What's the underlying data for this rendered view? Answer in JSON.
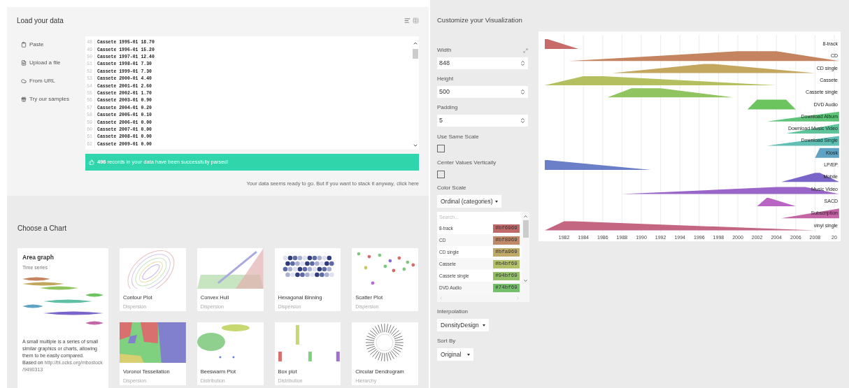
{
  "load_panel": {
    "title": "Load your data",
    "sources": [
      {
        "label": "Paste"
      },
      {
        "label": "Upload a file"
      },
      {
        "label": "From URL"
      },
      {
        "label": "Try our samples"
      }
    ],
    "data_lines": [
      {
        "number": "48",
        "text": "Cassete 1995-01 18.70"
      },
      {
        "number": "49",
        "text": "Cassete 1996-01 15.20"
      },
      {
        "number": "50",
        "text": "Cassete 1997-01 12.40"
      },
      {
        "number": "51",
        "text": "Cassete 1998-01 7.30"
      },
      {
        "number": "52",
        "text": "Cassete 1999-01 7.30"
      },
      {
        "number": "53",
        "text": "Cassete 2000-01 4.40"
      },
      {
        "number": "54",
        "text": "Cassete 2001-01 2.60"
      },
      {
        "number": "55",
        "text": "Cassete 2002-01 1.70"
      },
      {
        "number": "56",
        "text": "Cassete 2003-01 0.90"
      },
      {
        "number": "57",
        "text": "Cassete 2004-01 0.20"
      },
      {
        "number": "58",
        "text": "Cassete 2005-01 0.10"
      },
      {
        "number": "59",
        "text": "Cassete 2006-01 0.00"
      },
      {
        "number": "60",
        "text": "Cassete 2007-01 0.00"
      },
      {
        "number": "61",
        "text": "Cassete 2008-01 0.00"
      },
      {
        "number": "62",
        "text": "Cassete 2009-01 0.00"
      }
    ],
    "success_message": "**496** records in your data have been successfully parsed!",
    "stack_hint": "Your data seems ready to go. But if you want to stack it anyway,",
    "stack_link": "click here"
  },
  "chart_chooser": {
    "title": "Choose a Chart",
    "selected_chart": {
      "name": "Area graph",
      "category": "Time series",
      "description": "A small multiple is a series of small similar graphics or charts, allowing them to be easily compared.",
      "source_prefix": "Based on",
      "source_link_lines": [
        "http://bl.ocks.org/mbostock",
        "/9490313"
      ]
    },
    "charts": [
      {
        "name": "Contour Plot",
        "category": "Dispersion",
        "kind": "contour"
      },
      {
        "name": "Convex Hull",
        "category": "Dispersion",
        "kind": "hull"
      },
      {
        "name": "Hexagonal Binning",
        "category": "Dispersion",
        "kind": "hexbin"
      },
      {
        "name": "Scatter Plot",
        "category": "Dispersion",
        "kind": "scatter"
      },
      {
        "name": "Voronoi Tessellation",
        "category": "Dispersion",
        "kind": "voronoi"
      },
      {
        "name": "Beeswarm Plot",
        "category": "Distribution",
        "kind": "beeswarm"
      },
      {
        "name": "Box plot",
        "category": "Distribution",
        "kind": "boxplot"
      },
      {
        "name": "Circular Dendrogram",
        "category": "Hierarchy",
        "kind": "dendrogram"
      }
    ]
  },
  "customize": {
    "title": "Customize your Visualization",
    "width": {
      "label": "Width",
      "value": "848"
    },
    "height": {
      "label": "Height",
      "value": "500"
    },
    "padding": {
      "label": "Padding",
      "value": "5"
    },
    "same_scale": {
      "label": "Use Same Scale",
      "checked": false
    },
    "center_values": {
      "label": "Center Values Vertically",
      "checked": false
    },
    "color_scale": {
      "label": "Color Scale",
      "value": "Ordinal (categories)",
      "search_placeholder": "Search...",
      "items": [
        {
          "label": "8-track",
          "value": "#bf6969",
          "color": "#bf6969"
        },
        {
          "label": "CD",
          "value": "#bf8969",
          "color": "#bf8969"
        },
        {
          "label": "CD single",
          "value": "#bfa969",
          "color": "#bfa969"
        },
        {
          "label": "Cassete",
          "value": "#b4bf69",
          "color": "#b4bf69"
        },
        {
          "label": "Cassete single",
          "value": "#94bf69",
          "color": "#94bf69"
        },
        {
          "label": "DVD Audio",
          "value": "#74bf69",
          "color": "#74bf69"
        }
      ]
    },
    "interpolation": {
      "label": "Interpolation",
      "value": "DensityDesign"
    },
    "sort_by": {
      "label": "Sort By",
      "value": "Original"
    }
  },
  "preview": {
    "series": [
      {
        "label": "8-track",
        "color": "#c86a6a"
      },
      {
        "label": "CD",
        "color": "#c4845f"
      },
      {
        "label": "CD single",
        "color": "#c4a75f"
      },
      {
        "label": "Cassete",
        "color": "#b4bf5f"
      },
      {
        "label": "Cassete single",
        "color": "#8fc45f"
      },
      {
        "label": "DVD Audio",
        "color": "#6cc45f"
      },
      {
        "label": "Download Album",
        "color": "#5fc47a"
      },
      {
        "label": "Download Music Video",
        "color": "#5fc49a"
      },
      {
        "label": "Download Single",
        "color": "#5fbfb4"
      },
      {
        "label": "Kiosk",
        "color": "#5fa2c4"
      },
      {
        "label": "LP/EP",
        "color": "#6a7fc8"
      },
      {
        "label": "Mobile",
        "color": "#7a65c8"
      },
      {
        "label": "Music Video",
        "color": "#9a65c8"
      },
      {
        "label": "SACD",
        "color": "#b965c4"
      },
      {
        "label": "Subscription",
        "color": "#c465a6"
      },
      {
        "label": "vinyl single",
        "color": "#c46582"
      }
    ],
    "x_ticks": [
      "1982",
      "1984",
      "1986",
      "1988",
      "1990",
      "1992",
      "1994",
      "1996",
      "1998",
      "2000",
      "2002",
      "2004",
      "2006",
      "2008",
      "20"
    ]
  }
}
